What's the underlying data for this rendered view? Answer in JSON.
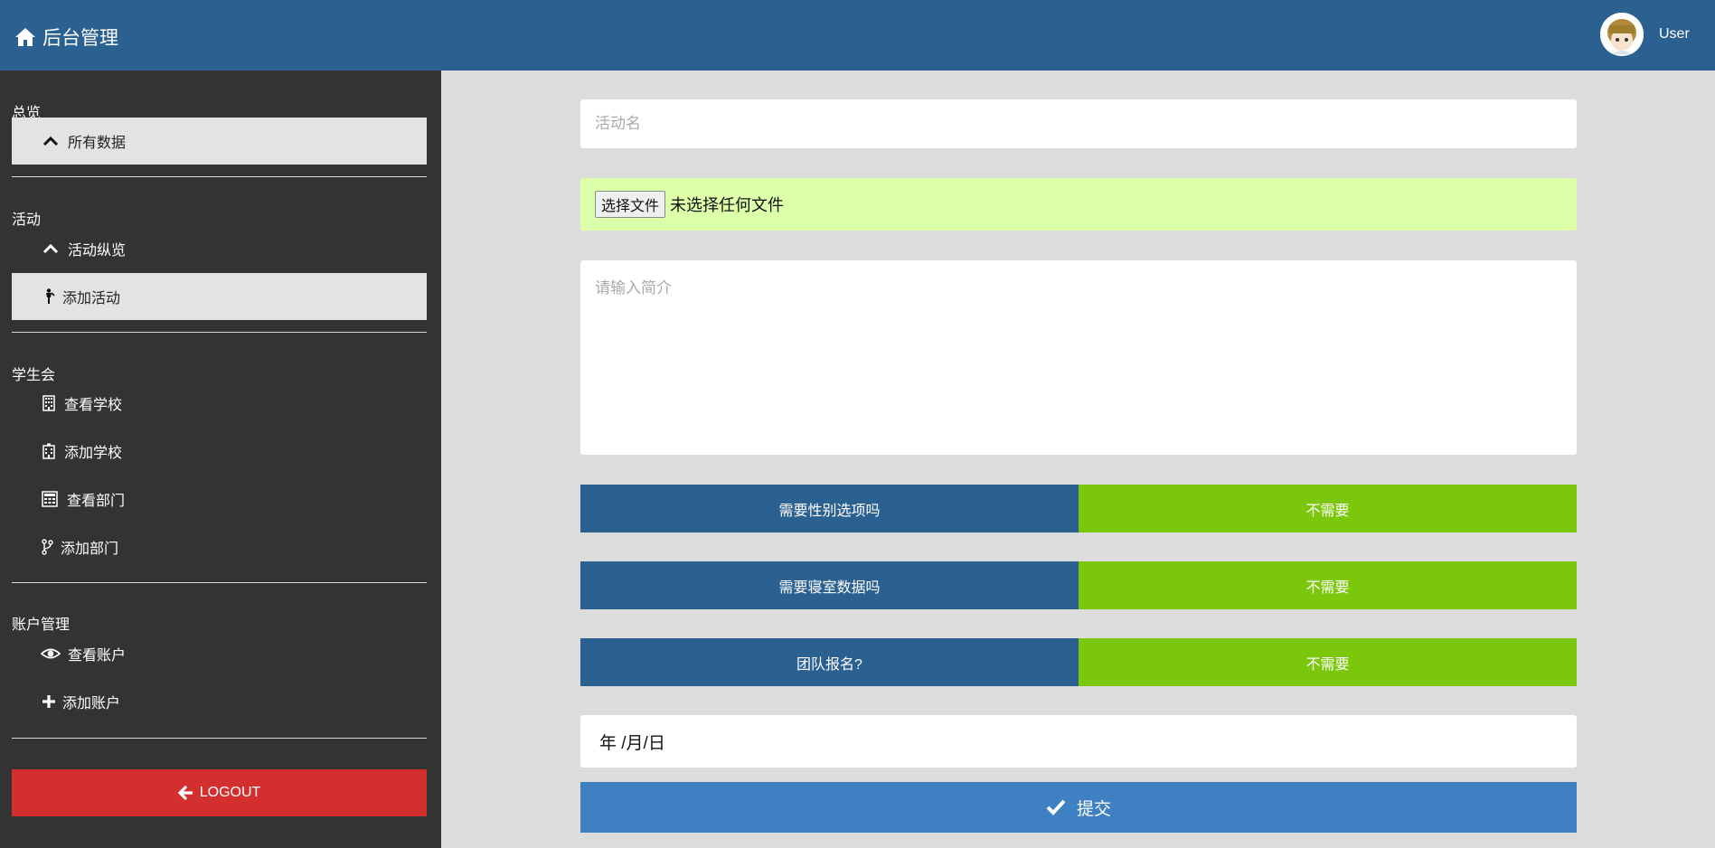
{
  "header": {
    "brand_title": "后台管理",
    "home_icon": "home-icon",
    "user_name": "User",
    "colors": {
      "bar": "#2b6190"
    }
  },
  "sidebar": {
    "sections": [
      {
        "label": "总览",
        "items": [
          {
            "label": "所有数据",
            "icon": "chevron-up-icon",
            "active": true
          }
        ]
      },
      {
        "label": "活动",
        "items": [
          {
            "label": "活动纵览",
            "icon": "chevron-up-icon",
            "active": false
          },
          {
            "label": "添加活动",
            "icon": "person-icon",
            "active": true
          }
        ]
      },
      {
        "label": "学生会",
        "items": [
          {
            "label": "查看学校",
            "icon": "building-icon",
            "active": false
          },
          {
            "label": "添加学校",
            "icon": "hospital-building-icon",
            "active": false
          },
          {
            "label": "查看部门",
            "icon": "calculator-icon",
            "active": false
          },
          {
            "label": "添加部门",
            "icon": "branch-icon",
            "active": false
          }
        ]
      },
      {
        "label": "账户管理",
        "items": [
          {
            "label": "查看账户",
            "icon": "eye-icon",
            "active": false
          },
          {
            "label": "添加账户",
            "icon": "plus-icon",
            "active": false
          }
        ]
      }
    ],
    "logout_label": "LOGOUT",
    "colors": {
      "background": "#333333",
      "logout": "#d32f2f",
      "active_item": "#e3e3e3"
    }
  },
  "form": {
    "activity_name_placeholder": "活动名",
    "file_button_label": "选择文件",
    "file_status": "未选择任何文件",
    "intro_placeholder": "请输入简介",
    "options": [
      {
        "question": "需要性别选项吗",
        "value": "不需要"
      },
      {
        "question": "需要寝室数据吗",
        "value": "不需要"
      },
      {
        "question": "团队报名?",
        "value": "不需要"
      }
    ],
    "date_placeholder": "年 /月/日",
    "submit_label": "提交",
    "colors": {
      "question_bg": "#2b6190",
      "answer_bg": "#7bc70c",
      "submit_bg": "#3f80c2",
      "file_bg": "#deffaa"
    }
  }
}
